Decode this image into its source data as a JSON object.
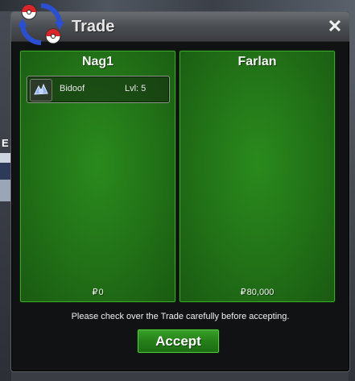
{
  "window": {
    "title": "Trade",
    "close_glyph": "✕"
  },
  "left_panel": {
    "player_name": "Nag1",
    "items": [
      {
        "name": "Bidoof",
        "level": "Lvl: 5",
        "icon": "pokeball-item-icon"
      }
    ],
    "currency_symbol": "₽",
    "money": "0"
  },
  "right_panel": {
    "player_name": "Farlan",
    "items": [],
    "currency_symbol": "₽",
    "money": "80,000"
  },
  "notice": "Please check over the Trade carefully before accepting.",
  "accept_label": "Accept",
  "background": {
    "char_label": "E"
  },
  "colors": {
    "panel_green": "#237518",
    "button_green": "#258019",
    "titlebar": "#4a4d52"
  }
}
